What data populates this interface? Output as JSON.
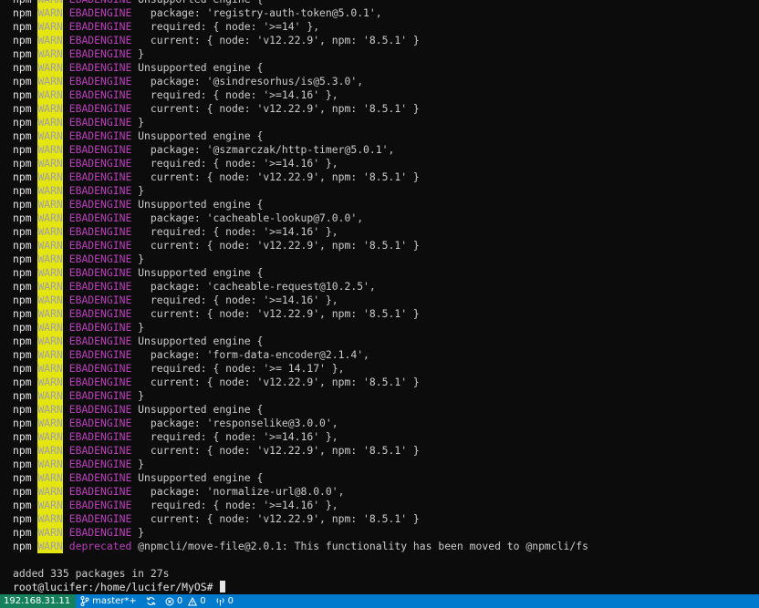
{
  "terminal": {
    "lines": [
      {
        "type": "warn",
        "code": "EBADENGINE",
        "message": "Unsupported engine {"
      },
      {
        "type": "warn",
        "code": "EBADENGINE",
        "message": "  package: 'registry-auth-token@5.0.1',"
      },
      {
        "type": "warn",
        "code": "EBADENGINE",
        "message": "  required: { node: '>=14' },"
      },
      {
        "type": "warn",
        "code": "EBADENGINE",
        "message": "  current: { node: 'v12.22.9', npm: '8.5.1' }"
      },
      {
        "type": "warn",
        "code": "EBADENGINE",
        "message": "}"
      },
      {
        "type": "warn",
        "code": "EBADENGINE",
        "message": "Unsupported engine {"
      },
      {
        "type": "warn",
        "code": "EBADENGINE",
        "message": "  package: '@sindresorhus/is@5.3.0',"
      },
      {
        "type": "warn",
        "code": "EBADENGINE",
        "message": "  required: { node: '>=14.16' },"
      },
      {
        "type": "warn",
        "code": "EBADENGINE",
        "message": "  current: { node: 'v12.22.9', npm: '8.5.1' }"
      },
      {
        "type": "warn",
        "code": "EBADENGINE",
        "message": "}"
      },
      {
        "type": "warn",
        "code": "EBADENGINE",
        "message": "Unsupported engine {"
      },
      {
        "type": "warn",
        "code": "EBADENGINE",
        "message": "  package: '@szmarczak/http-timer@5.0.1',"
      },
      {
        "type": "warn",
        "code": "EBADENGINE",
        "message": "  required: { node: '>=14.16' },"
      },
      {
        "type": "warn",
        "code": "EBADENGINE",
        "message": "  current: { node: 'v12.22.9', npm: '8.5.1' }"
      },
      {
        "type": "warn",
        "code": "EBADENGINE",
        "message": "}"
      },
      {
        "type": "warn",
        "code": "EBADENGINE",
        "message": "Unsupported engine {"
      },
      {
        "type": "warn",
        "code": "EBADENGINE",
        "message": "  package: 'cacheable-lookup@7.0.0',"
      },
      {
        "type": "warn",
        "code": "EBADENGINE",
        "message": "  required: { node: '>=14.16' },"
      },
      {
        "type": "warn",
        "code": "EBADENGINE",
        "message": "  current: { node: 'v12.22.9', npm: '8.5.1' }"
      },
      {
        "type": "warn",
        "code": "EBADENGINE",
        "message": "}"
      },
      {
        "type": "warn",
        "code": "EBADENGINE",
        "message": "Unsupported engine {"
      },
      {
        "type": "warn",
        "code": "EBADENGINE",
        "message": "  package: 'cacheable-request@10.2.5',"
      },
      {
        "type": "warn",
        "code": "EBADENGINE",
        "message": "  required: { node: '>=14.16' },"
      },
      {
        "type": "warn",
        "code": "EBADENGINE",
        "message": "  current: { node: 'v12.22.9', npm: '8.5.1' }"
      },
      {
        "type": "warn",
        "code": "EBADENGINE",
        "message": "}"
      },
      {
        "type": "warn",
        "code": "EBADENGINE",
        "message": "Unsupported engine {"
      },
      {
        "type": "warn",
        "code": "EBADENGINE",
        "message": "  package: 'form-data-encoder@2.1.4',"
      },
      {
        "type": "warn",
        "code": "EBADENGINE",
        "message": "  required: { node: '>= 14.17' },"
      },
      {
        "type": "warn",
        "code": "EBADENGINE",
        "message": "  current: { node: 'v12.22.9', npm: '8.5.1' }"
      },
      {
        "type": "warn",
        "code": "EBADENGINE",
        "message": "}"
      },
      {
        "type": "warn",
        "code": "EBADENGINE",
        "message": "Unsupported engine {"
      },
      {
        "type": "warn",
        "code": "EBADENGINE",
        "message": "  package: 'responselike@3.0.0',"
      },
      {
        "type": "warn",
        "code": "EBADENGINE",
        "message": "  required: { node: '>=14.16' },"
      },
      {
        "type": "warn",
        "code": "EBADENGINE",
        "message": "  current: { node: 'v12.22.9', npm: '8.5.1' }"
      },
      {
        "type": "warn",
        "code": "EBADENGINE",
        "message": "}"
      },
      {
        "type": "warn",
        "code": "EBADENGINE",
        "message": "Unsupported engine {"
      },
      {
        "type": "warn",
        "code": "EBADENGINE",
        "message": "  package: 'normalize-url@8.0.0',"
      },
      {
        "type": "warn",
        "code": "EBADENGINE",
        "message": "  required: { node: '>=14.16' },"
      },
      {
        "type": "warn",
        "code": "EBADENGINE",
        "message": "  current: { node: 'v12.22.9', npm: '8.5.1' }"
      },
      {
        "type": "warn",
        "code": "EBADENGINE",
        "message": "}"
      },
      {
        "type": "warn",
        "code": "deprecated",
        "message": "@npmcli/move-file@2.0.1: This functionality has been moved to @npmcli/fs"
      },
      {
        "type": "blank",
        "message": ""
      },
      {
        "type": "plain",
        "message": "added 335 packages in 27s"
      },
      {
        "type": "prompt",
        "message": "root@lucifer:/home/lucifer/MyOS# "
      }
    ],
    "npm_label": "npm",
    "warn_label": "WARN",
    "colors": {
      "background": "#0c0c0c",
      "text": "#cccccc",
      "warn_bg": "#e5e510",
      "warn_fg": "#a0a0a0",
      "code": "#bc3fbc"
    }
  },
  "statusbar": {
    "host": "192.168.31.11",
    "branch": "master*+",
    "errors": "0",
    "warnings": "0",
    "ports": "0",
    "colors": {
      "background": "#007acc",
      "host_background": "#16825d"
    }
  }
}
